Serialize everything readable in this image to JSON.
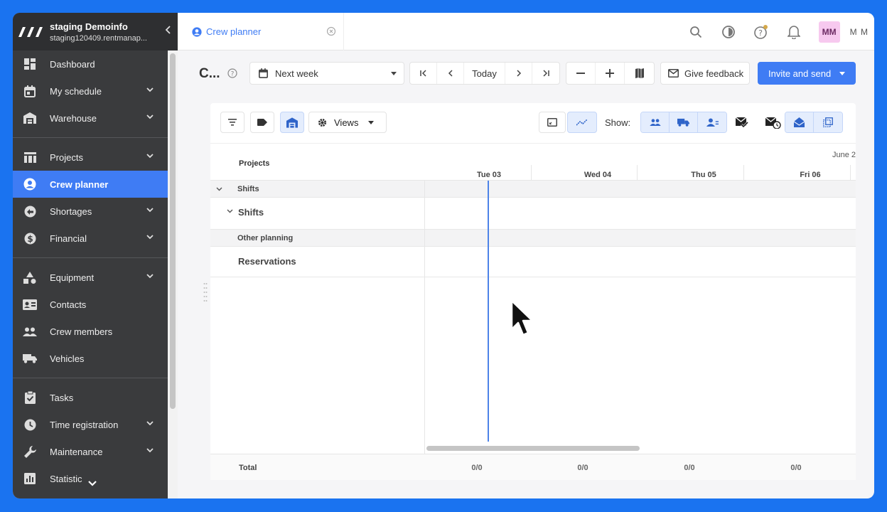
{
  "sidebar": {
    "org_name": "staging Demoinfo",
    "org_sub": "staging120409.rentmanap...",
    "items": [
      {
        "label": "Dashboard",
        "icon": "dashboard-icon",
        "chevron": false
      },
      {
        "label": "My schedule",
        "icon": "calendar-icon",
        "chevron": true
      },
      {
        "label": "Warehouse",
        "icon": "warehouse-icon",
        "chevron": true
      },
      {
        "label": "Projects",
        "icon": "projects-icon",
        "chevron": true
      },
      {
        "label": "Crew planner",
        "icon": "user-circle-icon",
        "chevron": false,
        "active": true
      },
      {
        "label": "Shortages",
        "icon": "shortages-icon",
        "chevron": true
      },
      {
        "label": "Financial",
        "icon": "dollar-icon",
        "chevron": true
      },
      {
        "label": "Equipment",
        "icon": "shapes-icon",
        "chevron": true
      },
      {
        "label": "Contacts",
        "icon": "contact-card-icon",
        "chevron": false
      },
      {
        "label": "Crew members",
        "icon": "people-icon",
        "chevron": false
      },
      {
        "label": "Vehicles",
        "icon": "truck-icon",
        "chevron": false
      },
      {
        "label": "Tasks",
        "icon": "clipboard-check-icon",
        "chevron": false
      },
      {
        "label": "Time registration",
        "icon": "clock-icon",
        "chevron": true
      },
      {
        "label": "Maintenance",
        "icon": "wrench-icon",
        "chevron": true
      },
      {
        "label": "Statistic",
        "icon": "bar-chart-icon",
        "chevron": false
      }
    ]
  },
  "topbar": {
    "tab_label": "Crew planner",
    "avatar": "MM",
    "user": "M M"
  },
  "toolbar": {
    "page_title": "C...",
    "week_label": "Next week",
    "today_label": "Today",
    "feedback_label": "Give feedback",
    "invite_label": "Invite and send"
  },
  "panel": {
    "views_label": "Views",
    "show_label": "Show:"
  },
  "grid": {
    "projects_header": "Projects",
    "month": "June 2",
    "days": [
      "Tue 03",
      "Wed 04",
      "Thu 05",
      "Fri 06"
    ],
    "rows": {
      "shifts_group": "Shifts",
      "shifts": "Shifts",
      "other_planning": "Other planning",
      "reservations": "Reservations"
    },
    "total_label": "Total",
    "totals": [
      "0/0",
      "0/0",
      "0/0",
      "0/0"
    ]
  },
  "colors": {
    "accent": "#3f7cf4",
    "sidebar_bg": "#3a3b3d",
    "frame": "#1a73f0"
  }
}
